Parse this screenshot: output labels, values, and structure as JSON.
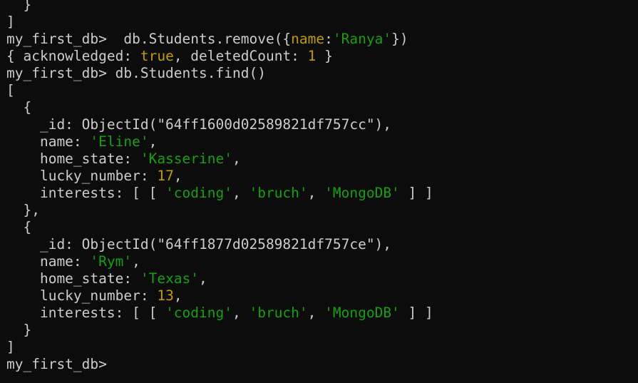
{
  "theme": {
    "background": "#0c0c0c",
    "default": "#cccccc",
    "string": "#13a10e",
    "number": "#c19c00",
    "boolean": "#c19c00",
    "key_highlight": "#c19c00"
  },
  "lines": [
    [
      {
        "t": "  }",
        "c": "default"
      }
    ],
    [
      {
        "t": "]",
        "c": "default"
      }
    ],
    [
      {
        "t": "my_first_db>  db.Students.remove({",
        "c": "default"
      },
      {
        "t": "name",
        "c": "key_highlight"
      },
      {
        "t": ":",
        "c": "default"
      },
      {
        "t": "'Ranya'",
        "c": "string"
      },
      {
        "t": "})",
        "c": "default"
      }
    ],
    [
      {
        "t": "{ acknowledged: ",
        "c": "default"
      },
      {
        "t": "true",
        "c": "boolean"
      },
      {
        "t": ", deletedCount: ",
        "c": "default"
      },
      {
        "t": "1",
        "c": "number"
      },
      {
        "t": " }",
        "c": "default"
      }
    ],
    [
      {
        "t": "my_first_db> db.Students.find()",
        "c": "default"
      }
    ],
    [
      {
        "t": "[",
        "c": "default"
      }
    ],
    [
      {
        "t": "  {",
        "c": "default"
      }
    ],
    [
      {
        "t": "    _id: ObjectId(\"64ff1600d02589821df757cc\"),",
        "c": "default"
      }
    ],
    [
      {
        "t": "    name: ",
        "c": "default"
      },
      {
        "t": "'Eline'",
        "c": "string"
      },
      {
        "t": ",",
        "c": "default"
      }
    ],
    [
      {
        "t": "    home_state: ",
        "c": "default"
      },
      {
        "t": "'Kasserine'",
        "c": "string"
      },
      {
        "t": ",",
        "c": "default"
      }
    ],
    [
      {
        "t": "    lucky_number: ",
        "c": "default"
      },
      {
        "t": "17",
        "c": "number"
      },
      {
        "t": ",",
        "c": "default"
      }
    ],
    [
      {
        "t": "    interests: [ [ ",
        "c": "default"
      },
      {
        "t": "'coding'",
        "c": "string"
      },
      {
        "t": ", ",
        "c": "default"
      },
      {
        "t": "'bruch'",
        "c": "string"
      },
      {
        "t": ", ",
        "c": "default"
      },
      {
        "t": "'MongoDB'",
        "c": "string"
      },
      {
        "t": " ] ]",
        "c": "default"
      }
    ],
    [
      {
        "t": "  },",
        "c": "default"
      }
    ],
    [
      {
        "t": "  {",
        "c": "default"
      }
    ],
    [
      {
        "t": "    _id: ObjectId(\"64ff1877d02589821df757ce\"),",
        "c": "default"
      }
    ],
    [
      {
        "t": "    name: ",
        "c": "default"
      },
      {
        "t": "'Rym'",
        "c": "string"
      },
      {
        "t": ",",
        "c": "default"
      }
    ],
    [
      {
        "t": "    home_state: ",
        "c": "default"
      },
      {
        "t": "'Texas'",
        "c": "string"
      },
      {
        "t": ",",
        "c": "default"
      }
    ],
    [
      {
        "t": "    lucky_number: ",
        "c": "default"
      },
      {
        "t": "13",
        "c": "number"
      },
      {
        "t": ",",
        "c": "default"
      }
    ],
    [
      {
        "t": "    interests: [ [ ",
        "c": "default"
      },
      {
        "t": "'coding'",
        "c": "string"
      },
      {
        "t": ", ",
        "c": "default"
      },
      {
        "t": "'bruch'",
        "c": "string"
      },
      {
        "t": ", ",
        "c": "default"
      },
      {
        "t": "'MongoDB'",
        "c": "string"
      },
      {
        "t": " ] ]",
        "c": "default"
      }
    ],
    [
      {
        "t": "  }",
        "c": "default"
      }
    ],
    [
      {
        "t": "]",
        "c": "default"
      }
    ],
    [
      {
        "t": "my_first_db> ",
        "c": "default"
      }
    ]
  ]
}
